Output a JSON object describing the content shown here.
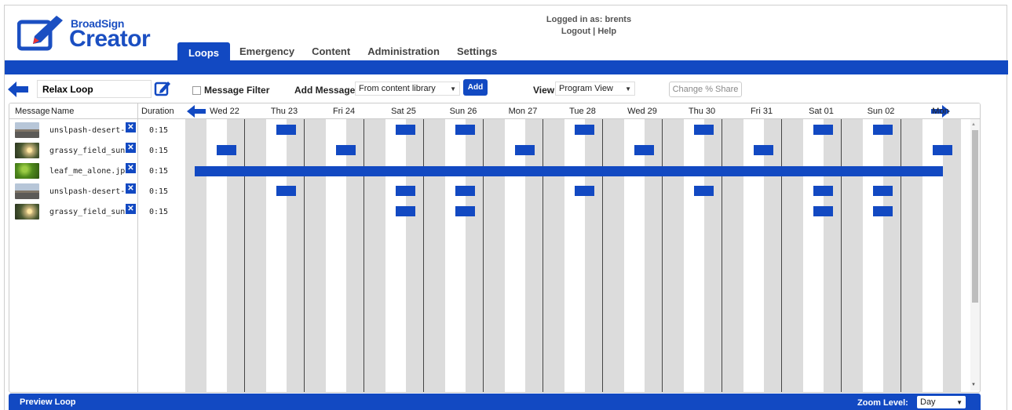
{
  "header": {
    "brand_small": "BroadSign",
    "brand_large": "Creator",
    "login_text": "Logged in as: brents",
    "logout": "Logout",
    "separator": "|",
    "help": "Help"
  },
  "tabs": [
    {
      "label": "Loops",
      "active": true
    },
    {
      "label": "Emergency",
      "active": false
    },
    {
      "label": "Content",
      "active": false
    },
    {
      "label": "Administration",
      "active": false
    },
    {
      "label": "Settings",
      "active": false
    }
  ],
  "toolbar": {
    "loop_name": "Relax Loop",
    "message_filter_label": "Message Filter",
    "add_message_label": "Add Message",
    "add_message_source": "From content library",
    "add_button": "Add",
    "view_label": "View",
    "view_value": "Program View",
    "change_share": "Change % Share"
  },
  "table": {
    "col_message": "Message",
    "col_name": "Name",
    "col_duration": "Duration",
    "rows": [
      {
        "thumb": "desert",
        "name": "unslpash-desert-road.jpg",
        "duration": "0:15"
      },
      {
        "thumb": "sunset",
        "name": "grassy_field_sunset.jpg",
        "duration": "0:15"
      },
      {
        "thumb": "leaf",
        "name": "leaf_me_alone.jpg",
        "duration": "0:15"
      },
      {
        "thumb": "desert",
        "name": "unslpash-desert-road.jpg",
        "duration": "0:15"
      },
      {
        "thumb": "sunset",
        "name": "grassy_field_sunset.jpg",
        "duration": "0:15"
      }
    ]
  },
  "timeline": {
    "days": [
      "Wed 22",
      "Thu 23",
      "Fri 24",
      "Sat 25",
      "Sun 26",
      "Mon 27",
      "Tue 28",
      "Wed 29",
      "Thu 30",
      "Fri 31",
      "Sat 01",
      "Sun 02",
      "Mon"
    ],
    "schedule": [
      [
        1,
        3,
        4,
        6,
        8,
        10,
        11
      ],
      [
        0,
        2,
        5,
        7,
        9,
        12
      ],
      "all",
      [
        1,
        3,
        4,
        6,
        8,
        10,
        11
      ],
      [
        3,
        4,
        10,
        11
      ]
    ]
  },
  "footer": {
    "preview": "Preview Loop",
    "zoom_label": "Zoom Level:",
    "zoom_value": "Day"
  },
  "colors": {
    "brand_blue": "#1249c2",
    "stripe_gray": "#dcdcdc"
  }
}
